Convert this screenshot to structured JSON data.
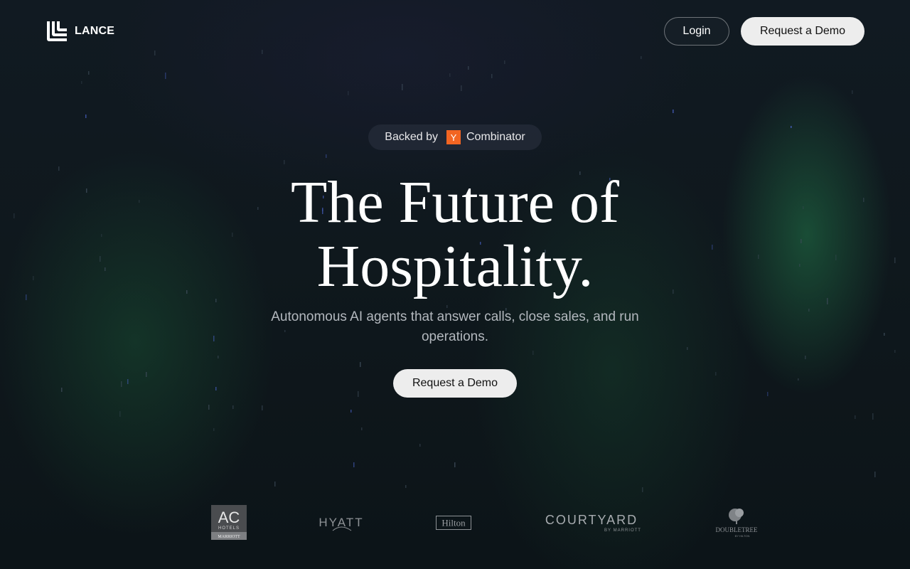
{
  "header": {
    "brand_name": "LANCE",
    "login_label": "Login",
    "demo_label": "Request a Demo"
  },
  "hero": {
    "badge_prefix": "Backed by",
    "badge_logo_letter": "Y",
    "badge_name": "Combinator",
    "headline_line1": "The Future of",
    "headline_line2": "Hospitality.",
    "subtitle": "Autonomous AI agents that answer calls, close sales, and run operations.",
    "cta_label": "Request a Demo"
  },
  "logos": {
    "ac": {
      "line1": "AC",
      "line2": "HOTELS",
      "line3": "MARRIOTT"
    },
    "hyatt": "HYATT",
    "hilton": "Hilton",
    "courtyard": {
      "name": "COURTYARD",
      "sub": "BY MARRIOTT"
    },
    "doubletree": {
      "name": "DOUBLETREE",
      "sub": "BY HILTON"
    }
  },
  "colors": {
    "background": "#0d1419",
    "aurora_green": "#22784a",
    "button_light": "#ededed",
    "yc_orange": "#f26522",
    "subtitle_gray": "#b3b8be"
  },
  "icons": {
    "brand": "lance-logo-icon",
    "badge": "y-combinator-logo-icon"
  }
}
